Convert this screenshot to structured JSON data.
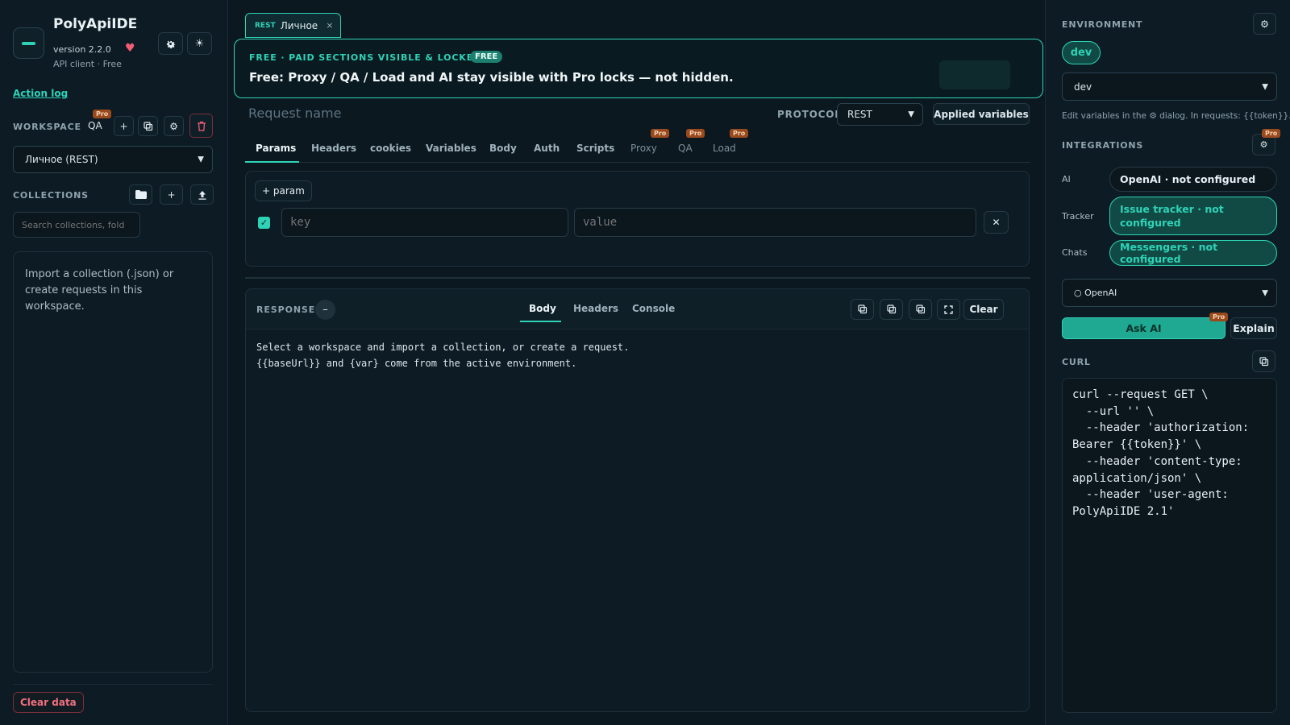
{
  "app": {
    "name": "PolyApiIDE",
    "version": "version 2.2.0",
    "subtitle": "API client · Free",
    "action_log": "Action log",
    "theme_icon": "sun-icon",
    "settings_icon": "gear-icon"
  },
  "workspace": {
    "label": "WORKSPACE",
    "name": "QA",
    "pro_badge": "Pro",
    "selected": "Личное (REST)"
  },
  "collections": {
    "label": "COLLECTIONS",
    "search_placeholder": "Search collections, fold",
    "empty_text": "Import a collection (.json) or create requests in this workspace."
  },
  "sidebar_footer": {
    "clear_data": "Clear data"
  },
  "request_tab": {
    "protocol": "REST",
    "name": "Личное",
    "close": "×"
  },
  "banner": {
    "label": "FREE · PAID SECTIONS VISIBLE & LOCKED",
    "badge": "FREE",
    "text": "Free: Proxy / QA / Load and AI stay visible with Pro locks — not hidden."
  },
  "request": {
    "name_placeholder": "Request name",
    "protocol_label": "PROTOCOL",
    "protocol_value": "REST",
    "applied_variables": "Applied variables",
    "tabs": [
      {
        "label": "Params",
        "active": true
      },
      {
        "label": "Headers"
      },
      {
        "label": "cookies"
      },
      {
        "label": "Variables"
      },
      {
        "label": "Body"
      },
      {
        "label": "Auth"
      },
      {
        "label": "Scripts"
      },
      {
        "label": "Proxy",
        "pro": "Pro"
      },
      {
        "label": "QA",
        "pro": "Pro"
      },
      {
        "label": "Load",
        "pro": "Pro"
      }
    ],
    "add_param": "+ param",
    "param_key_placeholder": "key",
    "param_value_placeholder": "value",
    "param_enabled": true
  },
  "response": {
    "label": "RESPONSE",
    "collapse": "–",
    "tabs": [
      {
        "label": "Body",
        "active": true
      },
      {
        "label": "Headers"
      },
      {
        "label": "Console"
      }
    ],
    "clear": "Clear",
    "body": "Select a workspace and import a collection, or create a request.\n{{baseUrl}} and {var} come from the active environment."
  },
  "environment": {
    "label": "ENVIRONMENT",
    "active_pill": "dev",
    "selected": "dev",
    "hint": "Edit variables in the ⚙ dialog. In requests: {{token}}."
  },
  "integrations": {
    "label": "INTEGRATIONS",
    "pro_badge": "Pro",
    "rows": [
      {
        "label": "AI",
        "value": "OpenAI · not configured"
      },
      {
        "label": "Tracker",
        "value": "Issue tracker · not configured"
      },
      {
        "label": "Chats",
        "value": "Messengers · not configured"
      }
    ],
    "ai_provider": "○ OpenAI",
    "ask_ai": "Ask AI",
    "ask_ai_pro": "Pro",
    "explain": "Explain"
  },
  "curl": {
    "label": "CURL",
    "text": "curl --request GET \\\n  --url '' \\\n  --header 'authorization: Bearer {{token}}' \\\n  --header 'content-type: application/json' \\\n  --header 'user-agent: PolyApiIDE 2.1'"
  },
  "colors": {
    "accent": "#2ed3b7",
    "background": "#0c1820",
    "danger": "#f25d72",
    "pro_badge": "#9b4a1e"
  }
}
